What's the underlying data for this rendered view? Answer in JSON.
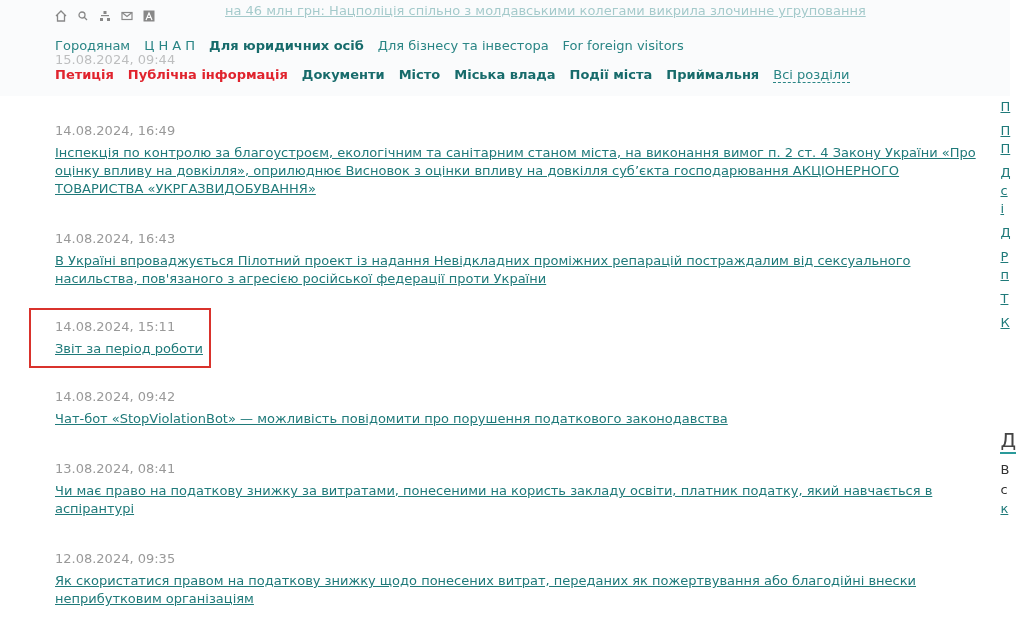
{
  "background_news": {
    "headline": "на 46 млн грн: Нацполіція спільно з молдавськими колегами викрила злочинне угруповання",
    "date": "15.08.2024, 09:44"
  },
  "header": {
    "top_links": [
      {
        "label": "Городянам",
        "bold": false
      },
      {
        "label": "Ц Н А П",
        "bold": false
      },
      {
        "label": "Для юридичних осіб",
        "bold": true
      },
      {
        "label": "Для бізнесу та інвестора",
        "bold": false
      },
      {
        "label": "For foreign visitors",
        "bold": false
      }
    ],
    "sections": [
      {
        "label": "Петиція",
        "kind": "accent"
      },
      {
        "label": "Публічна інформація",
        "kind": "accent"
      },
      {
        "label": "Документи",
        "kind": "normal"
      },
      {
        "label": "Місто",
        "kind": "normal"
      },
      {
        "label": "Міська влада",
        "kind": "normal"
      },
      {
        "label": "Події міста",
        "kind": "normal"
      },
      {
        "label": "Приймальня",
        "kind": "normal"
      },
      {
        "label": "Всі розділи",
        "kind": "all"
      }
    ]
  },
  "news": [
    {
      "date": "14.08.2024, 16:49",
      "title": "Інспекція по контролю за благоустроєм, екологічним та санітарним станом міста, на виконання вимог п. 2 ст. 4 Закону України «Про оцінку впливу на довкілля», оприлюднює Висновок з оцінки впливу на довкілля суб’єкта господарювання АКЦІОНЕРНОГО ТОВАРИСТВА «УКРГАЗВИДОБУВАННЯ»",
      "selected": false
    },
    {
      "date": "14.08.2024, 16:43",
      "title": "В Україні впроваджується Пілотний проект із надання Невідкладних проміжних репарацій постраждалим від сексуального насильства, пов'язаного з агресією російської федерації проти України",
      "selected": false
    },
    {
      "date": "14.08.2024, 15:11",
      "title": "Звіт за період роботи",
      "selected": true
    },
    {
      "date": "14.08.2024, 09:42",
      "title": "Чат-бот «StopViolationBot» — можливість повідомити про порушення податкового законодавства",
      "selected": false
    },
    {
      "date": "13.08.2024, 08:41",
      "title": "Чи має право на податкову знижку за витратами, понесеними на користь закладу освіти, платник податку, який навчається в аспірантурі",
      "selected": false
    },
    {
      "date": "12.08.2024, 09:35",
      "title": "Як скористатися правом на податкову знижку щодо понесених витрат, переданих як пожертвування або благодійні внески неприбутковим організаціям",
      "selected": false
    }
  ],
  "right_column": {
    "links": [
      [
        "П"
      ],
      [
        "П",
        "П"
      ],
      [
        "Д",
        "с",
        "і"
      ],
      [
        "Д"
      ],
      [
        "Р",
        "п"
      ],
      [
        "Т"
      ],
      [
        "К"
      ]
    ],
    "heading": "Д",
    "text_lines": [
      "В",
      "с"
    ],
    "link": "к"
  }
}
